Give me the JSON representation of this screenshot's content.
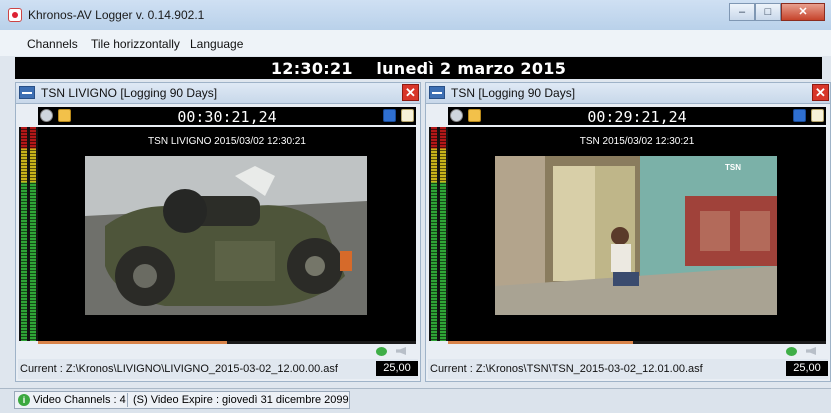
{
  "window": {
    "title": "Khronos-AV Logger  v. 0.14.902.1",
    "minimize_glyph": "–",
    "maximize_glyph": "□",
    "close_glyph": "✕"
  },
  "menu": [
    "Channels",
    "Tile horizzontally",
    "Language"
  ],
  "clock": "12:30:21    lunedì 2 marzo 2015",
  "panels": [
    {
      "title": "TSN LIVIGNO [Logging  90 Days]",
      "close_glyph": "✕",
      "timecode": "00:30:21,24",
      "caption": "TSN LIVIGNO 2015/03/02 12:30:21",
      "progress": 0.5,
      "current": "Current : Z:\\Kronos\\LIVIGNO\\LIVIGNO_2015-03-02_12.00.00.asf",
      "fps": "25,00"
    },
    {
      "title": "TSN [Logging  90 Days]",
      "close_glyph": "✕",
      "timecode": "00:29:21,24",
      "caption": "TSN 2015/03/02 12:30:21",
      "progress": 0.49,
      "current": "Current : Z:\\Kronos\\TSN\\TSN_2015-03-02_12.01.00.asf",
      "fps": "25,00"
    }
  ],
  "status": {
    "icon_glyph": "i",
    "channels": "Video Channels : 4",
    "expire": "(S) Video Expire : giovedì 31 dicembre 2099"
  },
  "colors": {
    "accent": "#d9844a",
    "vu_green": "#2fa536",
    "vu_yellow": "#c7b21a",
    "vu_red": "#b31818"
  },
  "icons": [
    "app-icon",
    "gear-icon",
    "folder-icon",
    "save-icon",
    "document-icon",
    "speaker-icon",
    "info-icon"
  ]
}
